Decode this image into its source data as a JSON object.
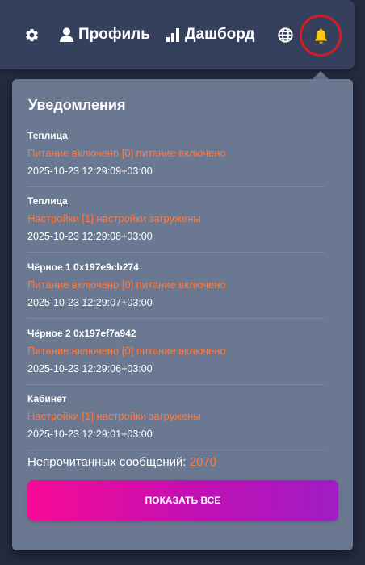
{
  "navbar": {
    "settings_icon": "gear-icon",
    "profile": {
      "icon": "user-icon",
      "label": "Профиль"
    },
    "dashboard": {
      "icon": "bar-chart-icon",
      "label": "Дашборд"
    },
    "language_icon": "globe-icon",
    "notifications_icon": "bell-icon",
    "highlight_color": "#d81a25",
    "bell_color": "#ffc61a"
  },
  "notifications": {
    "title": "Уведомления",
    "items": [
      {
        "source": "Теплица",
        "message": "Питание включено [0] питание включено",
        "timestamp": "2025-10-23 12:29:09+03:00"
      },
      {
        "source": "Теплица",
        "message": "Настройки [1] настройки загружены",
        "timestamp": "2025-10-23 12:29:08+03:00"
      },
      {
        "source": "Чёрное 1 0x197e9cb274",
        "message": "Питание включено [0] питание включено",
        "timestamp": "2025-10-23 12:29:07+03:00"
      },
      {
        "source": "Чёрное 2 0x197ef7a942",
        "message": "Питание включено [0] питание включено",
        "timestamp": "2025-10-23 12:29:06+03:00"
      },
      {
        "source": "Кабинет",
        "message": "Настройки [1] настройки загружены",
        "timestamp": "2025-10-23 12:29:01+03:00"
      }
    ],
    "unread_label": "Непрочитанных сообщений:",
    "unread_count": "2070",
    "show_all_label": "ПОКАЗАТЬ ВСЕ"
  },
  "colors": {
    "background": "#232b3e",
    "navbar": "#34405c",
    "panel": "#6a7891",
    "message_text": "#ff7a3f",
    "button_gradient_start": "#f80a95",
    "button_gradient_end": "#a01cc4"
  }
}
